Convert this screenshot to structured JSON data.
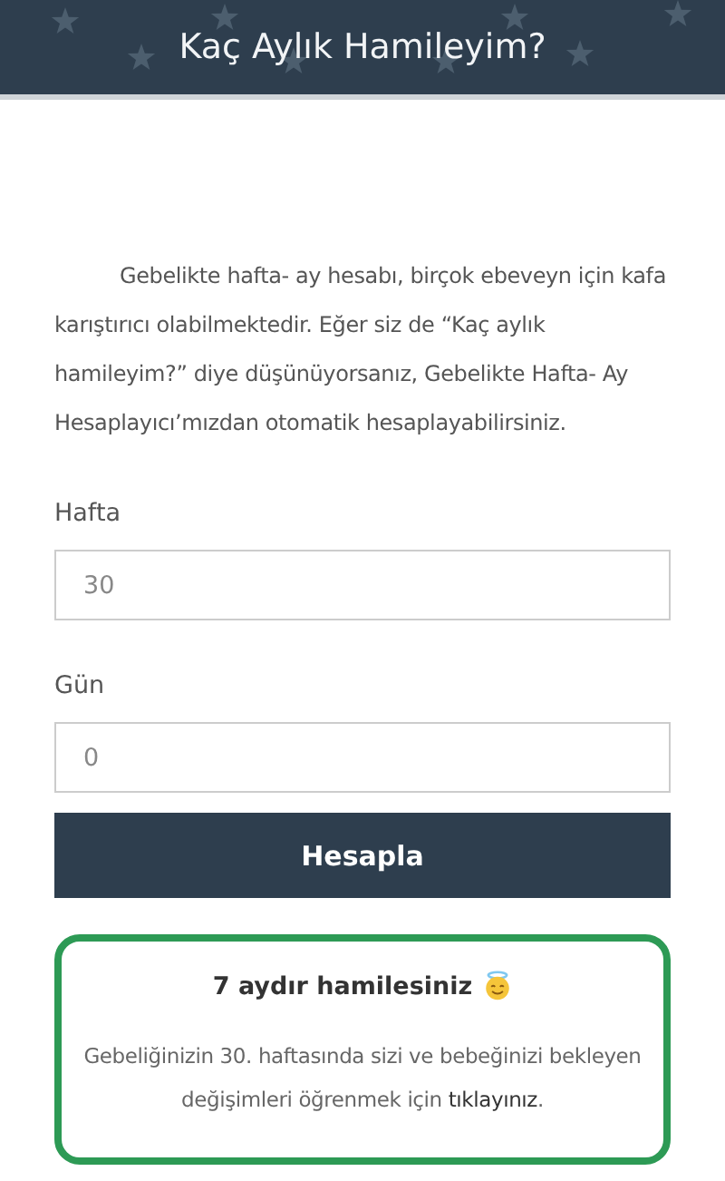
{
  "header": {
    "title": "Kaç Aylık Hamileyim?"
  },
  "intro": "Gebelikte hafta- ay hesabı, birçok ebeveyn için kafa karıştırıcı olabilmektedir. Eğer siz de “Kaç aylık hamileyim?” diye düşünüyorsanız, Gebelikte Hafta- Ay Hesaplayıcı’mızdan otomatik hesaplayabilirsiniz.",
  "fields": [
    {
      "label": "Hafta",
      "placeholder": "30"
    },
    {
      "label": "Gün",
      "placeholder": "0"
    }
  ],
  "button": "Hesapla",
  "result": {
    "title": "7 aydır hamilesiniz",
    "message": "Gebeliğinizin 30. haftasında sizi ve bebeğinizi bekleyen değişimleri öğrenmek için",
    "link": "tıklayınız",
    "suffix": "."
  }
}
